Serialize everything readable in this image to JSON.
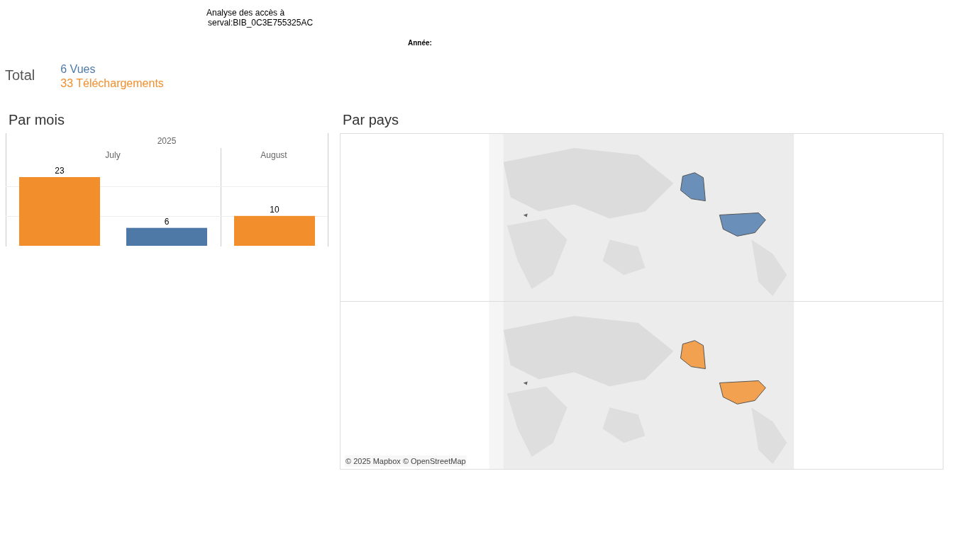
{
  "header": {
    "title_line_1": "Analyse des accès à",
    "title_line_2": "serval:BIB_0C3E755325AC",
    "year_filter_label": "Année:"
  },
  "total": {
    "label": "Total",
    "lines": [
      {
        "text": "6 Vues",
        "color": "#4e79a7"
      },
      {
        "text": "33 Téléchargements",
        "color": "#f28e2b"
      }
    ]
  },
  "by_month": {
    "title": "Par mois",
    "chart_data": {
      "type": "bar",
      "title": "2025",
      "categories": [
        "July",
        "August"
      ],
      "data_labels": true,
      "series": [
        {
          "color": "#f28e2b",
          "values": [
            23,
            10
          ]
        },
        {
          "color": "#4e79a7",
          "values": [
            6,
            null
          ]
        }
      ]
    }
  },
  "by_country": {
    "title": "Par pays",
    "attribution": "© 2025 Mapbox © OpenStreetMap"
  }
}
